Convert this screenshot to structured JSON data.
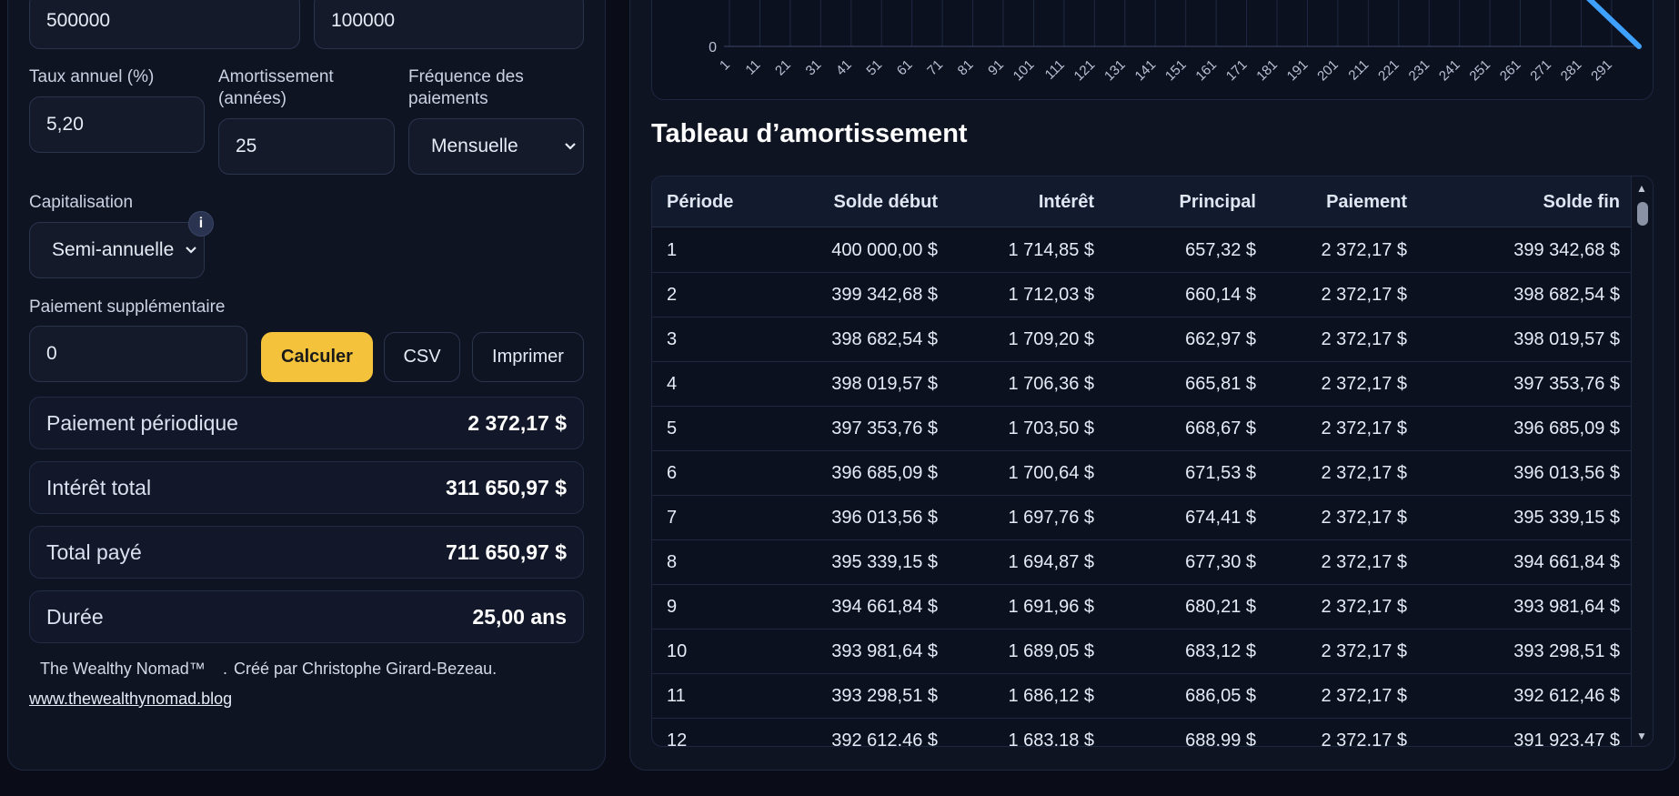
{
  "form": {
    "price_value": "500000",
    "down_value": "100000",
    "rate_label": "Taux annuel (%)",
    "rate_value": "5,20",
    "amort_label": "Amortissement (années)",
    "amort_value": "25",
    "freq_label": "Fréquence des paiements",
    "freq_value": "Mensuelle",
    "cap_label": "Capitalisation",
    "cap_value": "Semi-annuelle",
    "extra_label": "Paiement supplémentaire",
    "extra_value": "0",
    "calc_button": "Calculer",
    "csv_button": "CSV",
    "print_button": "Imprimer"
  },
  "summary": [
    {
      "label": "Paiement périodique",
      "value": "2 372,17 $"
    },
    {
      "label": "Intérêt total",
      "value": "311 650,97 $"
    },
    {
      "label": "Total payé",
      "value": "711 650,97 $"
    },
    {
      "label": "Durée",
      "value": "25,00 ans"
    }
  ],
  "footer": {
    "brand": "The Wealthy Nomad™",
    "sep": ".",
    "credit": "Créé par Christophe Girard-Bezeau.",
    "link": "www.thewealthynomad.blog"
  },
  "chart_data": {
    "type": "line",
    "x_ticks": [
      "1",
      "11",
      "21",
      "31",
      "41",
      "51",
      "61",
      "71",
      "81",
      "91",
      "101",
      "111",
      "121",
      "131",
      "141",
      "151",
      "161",
      "171",
      "181",
      "191",
      "201",
      "211",
      "221",
      "231",
      "241",
      "251",
      "261",
      "271",
      "281",
      "291"
    ],
    "y_ticks": [
      "0"
    ],
    "series": [
      {
        "color": "#3ea0ff",
        "points": [
          {
            "x": 281,
            "y": 55000
          },
          {
            "x": 300,
            "y": 0
          }
        ]
      }
    ]
  },
  "table": {
    "title": "Tableau d’amortissement",
    "columns": [
      "Période",
      "Solde début",
      "Intérêt",
      "Principal",
      "Paiement",
      "Solde fin"
    ],
    "rows": [
      [
        "1",
        "400 000,00 $",
        "1 714,85 $",
        "657,32 $",
        "2 372,17 $",
        "399 342,68 $"
      ],
      [
        "2",
        "399 342,68 $",
        "1 712,03 $",
        "660,14 $",
        "2 372,17 $",
        "398 682,54 $"
      ],
      [
        "3",
        "398 682,54 $",
        "1 709,20 $",
        "662,97 $",
        "2 372,17 $",
        "398 019,57 $"
      ],
      [
        "4",
        "398 019,57 $",
        "1 706,36 $",
        "665,81 $",
        "2 372,17 $",
        "397 353,76 $"
      ],
      [
        "5",
        "397 353,76 $",
        "1 703,50 $",
        "668,67 $",
        "2 372,17 $",
        "396 685,09 $"
      ],
      [
        "6",
        "396 685,09 $",
        "1 700,64 $",
        "671,53 $",
        "2 372,17 $",
        "396 013,56 $"
      ],
      [
        "7",
        "396 013,56 $",
        "1 697,76 $",
        "674,41 $",
        "2 372,17 $",
        "395 339,15 $"
      ],
      [
        "8",
        "395 339,15 $",
        "1 694,87 $",
        "677,30 $",
        "2 372,17 $",
        "394 661,84 $"
      ],
      [
        "9",
        "394 661,84 $",
        "1 691,96 $",
        "680,21 $",
        "2 372,17 $",
        "393 981,64 $"
      ],
      [
        "10",
        "393 981,64 $",
        "1 689,05 $",
        "683,12 $",
        "2 372,17 $",
        "393 298,51 $"
      ],
      [
        "11",
        "393 298,51 $",
        "1 686,12 $",
        "686,05 $",
        "2 372,17 $",
        "392 612,46 $"
      ],
      [
        "12",
        "392 612,46 $",
        "1 683,18 $",
        "688,99 $",
        "2 372,17 $",
        "391 923,47 $"
      ]
    ]
  }
}
